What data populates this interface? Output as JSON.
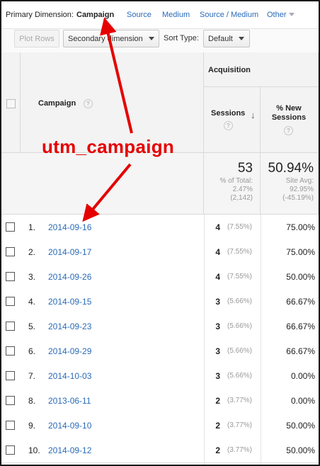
{
  "dimension_bar": {
    "label": "Primary Dimension:",
    "active": "Campaign",
    "links": [
      "Source",
      "Medium",
      "Source / Medium",
      "Other"
    ]
  },
  "toolbar": {
    "plot_rows": "Plot Rows",
    "secondary_dimension": "Secondary dimension",
    "sort_type_label": "Sort Type:",
    "sort_type_value": "Default"
  },
  "table": {
    "campaign_header": "Campaign",
    "acquisition_header": "Acquisition",
    "sessions_header": "Sessions",
    "new_sessions_header_line1": "% New",
    "new_sessions_header_line2": "Sessions",
    "summary": {
      "sessions_total": "53",
      "sessions_pct_label": "% of Total:",
      "sessions_pct": "2.47%",
      "sessions_of": "(2,142)",
      "new_sessions": "50.94%",
      "site_avg_label": "Site Avg:",
      "site_avg": "92.95%",
      "site_avg_diff": "(-45.19%)"
    },
    "rows": [
      {
        "index": "1.",
        "campaign": "2014-09-16",
        "sessions": "4",
        "sessions_pct": "(7.55%)",
        "new_sessions": "75.00%"
      },
      {
        "index": "2.",
        "campaign": "2014-09-17",
        "sessions": "4",
        "sessions_pct": "(7.55%)",
        "new_sessions": "75.00%"
      },
      {
        "index": "3.",
        "campaign": "2014-09-26",
        "sessions": "4",
        "sessions_pct": "(7.55%)",
        "new_sessions": "50.00%"
      },
      {
        "index": "4.",
        "campaign": "2014-09-15",
        "sessions": "3",
        "sessions_pct": "(5.66%)",
        "new_sessions": "66.67%"
      },
      {
        "index": "5.",
        "campaign": "2014-09-23",
        "sessions": "3",
        "sessions_pct": "(5.66%)",
        "new_sessions": "66.67%"
      },
      {
        "index": "6.",
        "campaign": "2014-09-29",
        "sessions": "3",
        "sessions_pct": "(5.66%)",
        "new_sessions": "66.67%"
      },
      {
        "index": "7.",
        "campaign": "2014-10-03",
        "sessions": "3",
        "sessions_pct": "(5.66%)",
        "new_sessions": "0.00%"
      },
      {
        "index": "8.",
        "campaign": "2013-06-11",
        "sessions": "2",
        "sessions_pct": "(3.77%)",
        "new_sessions": "0.00%"
      },
      {
        "index": "9.",
        "campaign": "2014-09-10",
        "sessions": "2",
        "sessions_pct": "(3.77%)",
        "new_sessions": "50.00%"
      },
      {
        "index": "10.",
        "campaign": "2014-09-12",
        "sessions": "2",
        "sessions_pct": "(3.77%)",
        "new_sessions": "50.00%"
      }
    ]
  },
  "annotation": {
    "text": "utm_campaign",
    "color": "#e50000"
  },
  "colors": {
    "link": "#2a6bb8",
    "annotation": "#e50000"
  },
  "icons": {
    "help": "help-icon",
    "sort": "sort-down-arrow-icon",
    "dropdown": "chevron-down-icon",
    "annotation_arrows": "red-arrow-icon"
  }
}
